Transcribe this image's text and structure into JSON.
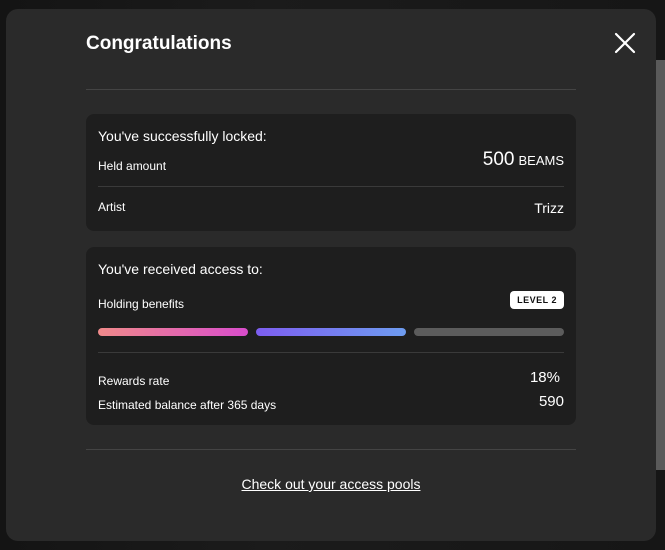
{
  "modal": {
    "title": "Congratulations",
    "close_icon": "close-icon"
  },
  "locked": {
    "heading": "You've successfully locked:",
    "held_amount_label": "Held amount",
    "held_amount_value": "500",
    "held_amount_unit": "BEAMS",
    "artist_label": "Artist",
    "artist_value": "Trizz"
  },
  "access": {
    "heading": "You've received access to:",
    "benefits_label": "Holding benefits",
    "level_badge": "LEVEL 2",
    "level_progress": {
      "filled_segments": 2,
      "total_segments": 3
    },
    "rewards_rate_label": "Rewards rate",
    "rewards_rate_value": "18%",
    "balance_label": "Estimated balance after 365 days",
    "balance_value": "590"
  },
  "footer": {
    "link_text": "Check out your access pools"
  },
  "colors": {
    "modal_bg": "#2a2a2a",
    "card_bg": "#1e1e1e",
    "segment_1": "#e06ab0",
    "segment_2": "#7a7ef0",
    "segment_empty": "#5c5c5c"
  }
}
